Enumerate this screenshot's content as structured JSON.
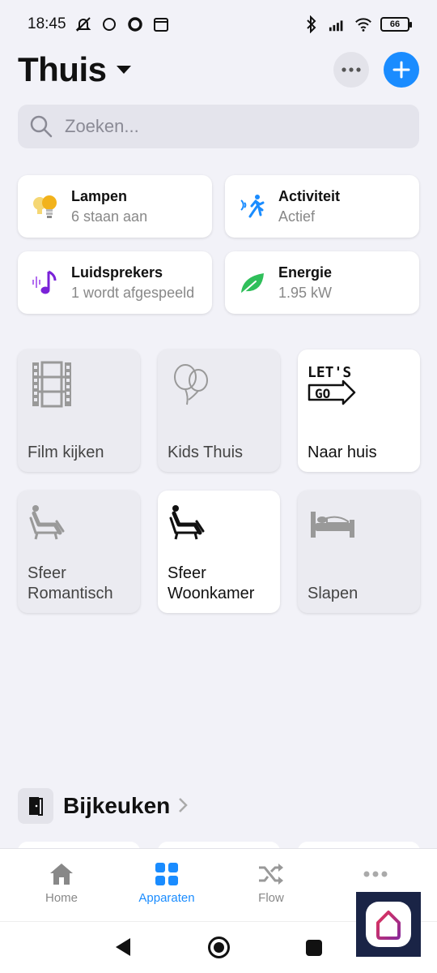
{
  "status_bar": {
    "time": "18:45",
    "battery": "66"
  },
  "header": {
    "title": "Thuis"
  },
  "search": {
    "placeholder": "Zoeken..."
  },
  "summary_cards": [
    {
      "label": "Lampen",
      "sub": "6 staan aan",
      "icon": "bulb-icon"
    },
    {
      "label": "Activiteit",
      "sub": "Actief",
      "icon": "motion-icon"
    },
    {
      "label": "Luidsprekers",
      "sub": "1 wordt afgespeeld",
      "icon": "music-note-icon"
    },
    {
      "label": "Energie",
      "sub": "1.95 kW",
      "icon": "leaf-icon"
    }
  ],
  "flows": [
    {
      "label": "Film kijken",
      "icon": "film-icon",
      "active": false
    },
    {
      "label": "Kids Thuis",
      "icon": "balloons-icon",
      "active": false
    },
    {
      "label": "Naar huis",
      "icon": "lets-go-icon",
      "active": true,
      "icon_text_1": "LET'S",
      "icon_text_2": "GO"
    },
    {
      "label": "Sfeer Romantisch",
      "icon": "recliner-icon",
      "active": false
    },
    {
      "label": "Sfeer Woonkamer",
      "icon": "recliner-icon",
      "active": true
    },
    {
      "label": "Slapen",
      "icon": "bed-icon",
      "active": false
    }
  ],
  "section": {
    "title": "Bijkeuken"
  },
  "tabs": [
    {
      "label": "Home",
      "icon": "home-icon",
      "active": false
    },
    {
      "label": "Apparaten",
      "icon": "grid-icon",
      "active": true
    },
    {
      "label": "Flow",
      "icon": "shuffle-icon",
      "active": false
    },
    {
      "label": "",
      "icon": "more-icon",
      "active": false
    }
  ],
  "colors": {
    "accent": "#1a8cff",
    "background": "#f2f2f8",
    "card": "#ffffff",
    "inactive_tile": "#ebebf1"
  }
}
